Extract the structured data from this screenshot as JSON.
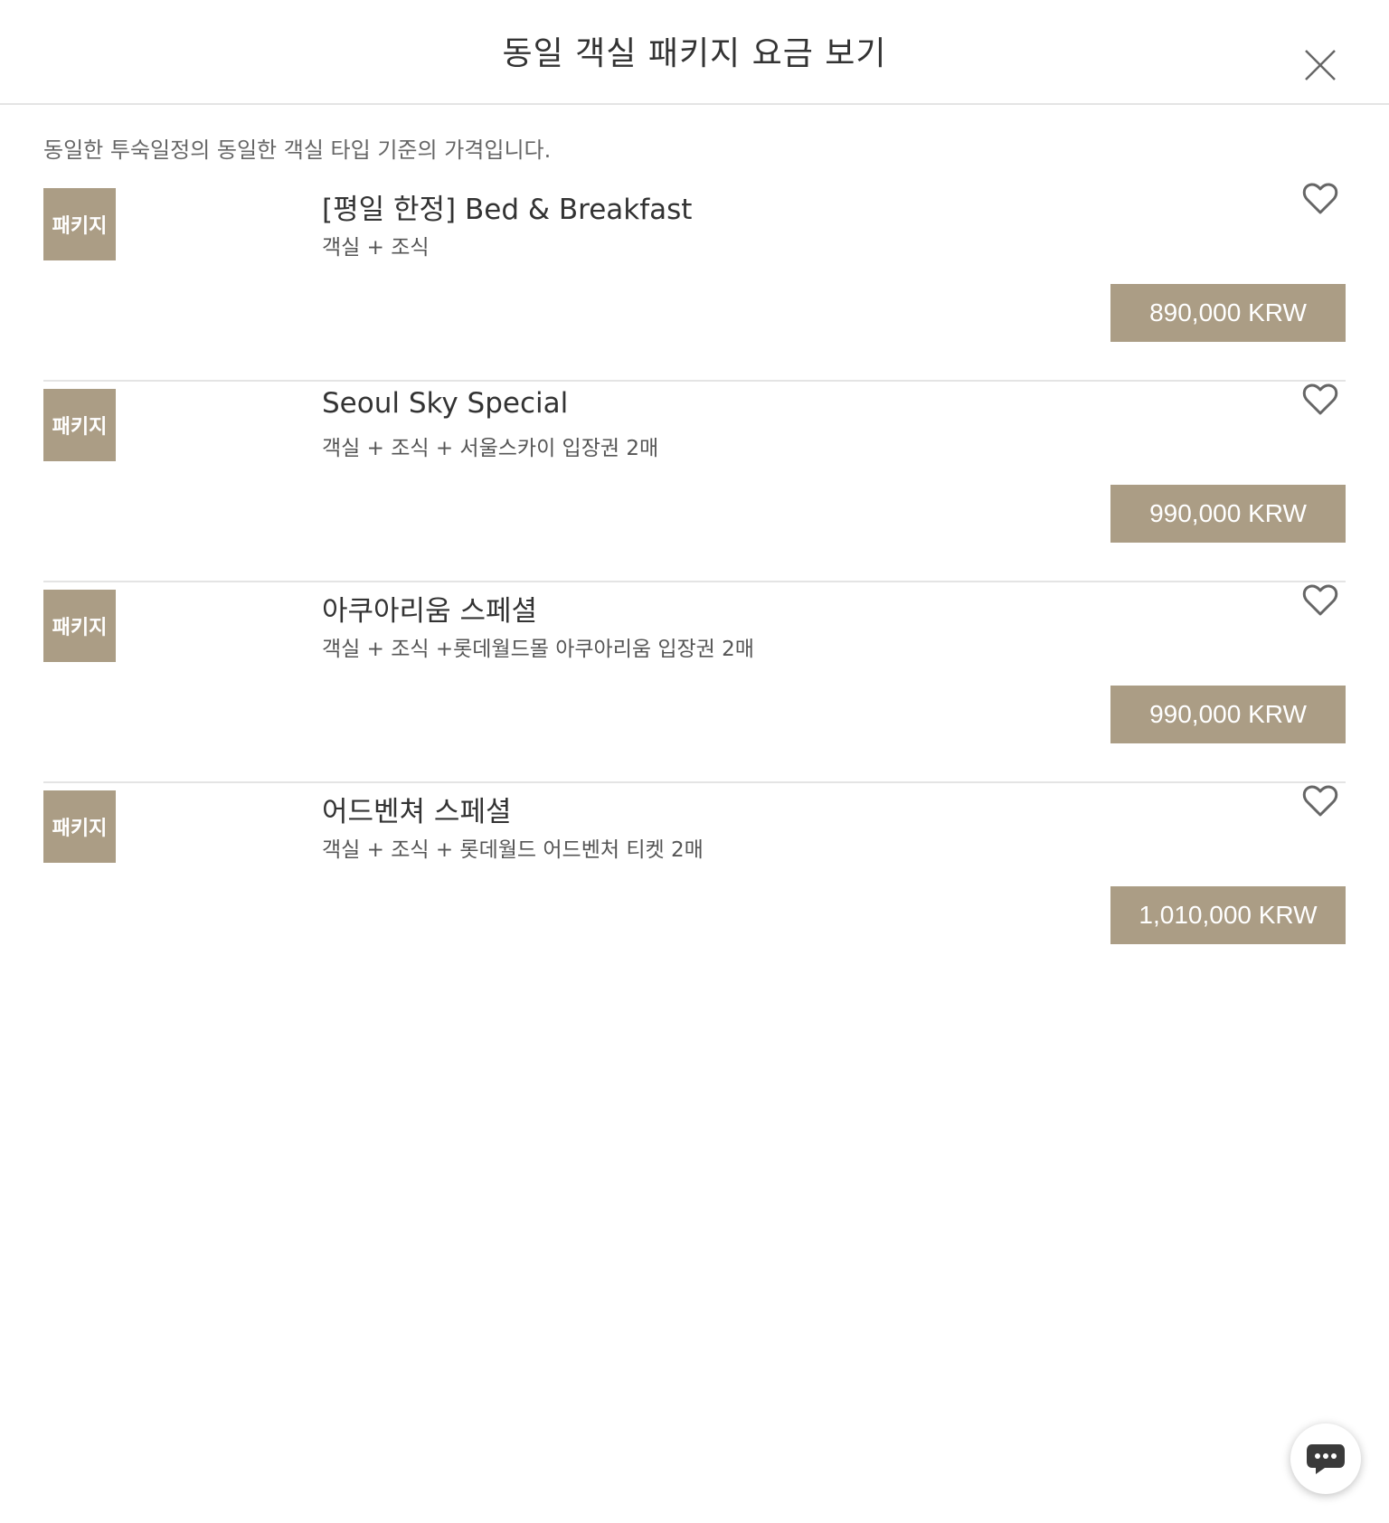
{
  "header": {
    "title": "동일 객실 패키지 요금 보기",
    "close_icon": "close-icon"
  },
  "notice": "동일한 투숙일정의 동일한 객실 타입 기준의 가격입니다.",
  "packages": [
    {
      "badge": "패키지",
      "title": "[평일 한정] Bed & Breakfast",
      "description": "객실 + 조식",
      "price": "890,000 KRW"
    },
    {
      "badge": "패키지",
      "title": "Seoul Sky Special",
      "description": "객실 + 조식 + 서울스카이 입장권 2매",
      "price": "990,000 KRW"
    },
    {
      "badge": "패키지",
      "title": "아쿠아리움 스페셜",
      "description": "객실 + 조식 +롯데월드몰 아쿠아리움 입장권 2매",
      "price": "990,000 KRW"
    },
    {
      "badge": "패키지",
      "title": "어드벤쳐 스페셜",
      "description": "객실 + 조식 + 롯데월드 어드벤처 티켓 2매",
      "price": "1,010,000 KRW"
    }
  ],
  "colors": {
    "accent": "#ab9d85",
    "divider": "#e4e4e4",
    "text": "#333333"
  },
  "icons": {
    "wishlist": "heart-icon",
    "chat": "chat-bubble-icon"
  }
}
